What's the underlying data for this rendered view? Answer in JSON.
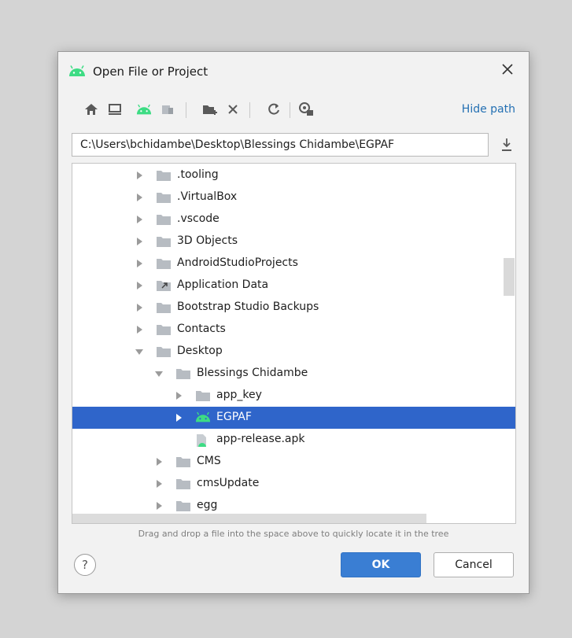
{
  "dialog": {
    "title": "Open File or Project",
    "title_icon": "android-icon",
    "close_icon": "close-icon"
  },
  "toolbar": {
    "icons": [
      "home-icon",
      "desktop-icon",
      "android-project-icon",
      "module-icon",
      "new-folder-icon",
      "delete-icon",
      "refresh-icon",
      "show-hidden-icon"
    ],
    "hide_path_label": "Hide path"
  },
  "path": {
    "value": "C:\\Users\\bchidambe\\Desktop\\Blessings Chidambe\\EGPAF"
  },
  "tree": {
    "items": [
      {
        "label": ".tooling",
        "state": "collapsed",
        "icon": "folder-icon",
        "depth": 0
      },
      {
        "label": ".VirtualBox",
        "state": "collapsed",
        "icon": "folder-icon",
        "depth": 0
      },
      {
        "label": ".vscode",
        "state": "collapsed",
        "icon": "folder-icon",
        "depth": 0
      },
      {
        "label": "3D Objects",
        "state": "collapsed",
        "icon": "folder-icon",
        "depth": 0
      },
      {
        "label": "AndroidStudioProjects",
        "state": "collapsed",
        "icon": "folder-icon",
        "depth": 0
      },
      {
        "label": "Application Data",
        "state": "collapsed",
        "icon": "folder-link-icon",
        "depth": 0
      },
      {
        "label": "Bootstrap Studio Backups",
        "state": "collapsed",
        "icon": "folder-icon",
        "depth": 0
      },
      {
        "label": "Contacts",
        "state": "collapsed",
        "icon": "folder-icon",
        "depth": 0
      },
      {
        "label": "Desktop",
        "state": "expanded",
        "icon": "folder-icon",
        "depth": 0
      },
      {
        "label": "Blessings Chidambe",
        "state": "expanded",
        "icon": "folder-icon",
        "depth": 1
      },
      {
        "label": "app_key",
        "state": "collapsed",
        "icon": "folder-icon",
        "depth": 2
      },
      {
        "label": "EGPAF",
        "state": "collapsed",
        "icon": "android-project-icon",
        "depth": 2,
        "selected": true
      },
      {
        "label": "app-release.apk",
        "state": "leaf",
        "icon": "apk-file-icon",
        "depth": 2
      },
      {
        "label": "CMS",
        "state": "collapsed",
        "icon": "folder-icon",
        "depth": 1
      },
      {
        "label": "cmsUpdate",
        "state": "collapsed",
        "icon": "folder-icon",
        "depth": 1
      },
      {
        "label": "egg",
        "state": "collapsed",
        "icon": "folder-icon",
        "depth": 1
      }
    ]
  },
  "hint": "Drag and drop a file into the space above to quickly locate it in the tree",
  "buttons": {
    "help": "?",
    "ok": "OK",
    "cancel": "Cancel"
  },
  "colors": {
    "accent": "#3a7ed3",
    "selection": "#2f65ca",
    "android_green": "#3ddc84",
    "link": "#2470b3"
  }
}
